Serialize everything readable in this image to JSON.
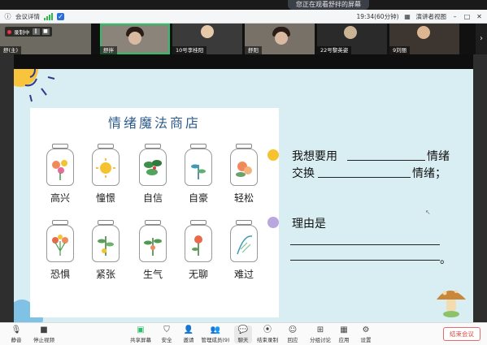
{
  "notice": "您正在观看舒拌的屏幕",
  "topbar": {
    "meeting_details": "会议详情",
    "time": "19:34(60分钟)",
    "view_mode": "演讲者视图",
    "icons": [
      "info-icon",
      "signal-icon",
      "shield-icon",
      "minimize-icon",
      "maximize-icon",
      "close-icon"
    ]
  },
  "participants": [
    {
      "name": "舒(主)",
      "recording_label": "录制中"
    },
    {
      "name": "舒拌"
    },
    {
      "name": "10号李桂阳"
    },
    {
      "name": "舒阳"
    },
    {
      "name": "22号黎英姿"
    },
    {
      "name": "9刘丽"
    }
  ],
  "slide": {
    "title": "情绪魔法商店",
    "emotions_row1": [
      "高兴",
      "憧憬",
      "自信",
      "自豪",
      "轻松"
    ],
    "emotions_row2": [
      "恐惧",
      "紧张",
      "生气",
      "无聊",
      "难过"
    ],
    "q1_line1_a": "我想要用",
    "q1_line1_b": "情绪",
    "q1_line2_a": "交换",
    "q1_line2_b": "情绪；",
    "q2_label": "理由是",
    "q2_end": "。",
    "bullet_colors": [
      "#f5c230",
      "#b9a8e0"
    ]
  },
  "toolbar": {
    "buttons": [
      {
        "label": "静音",
        "icon": "microphone-icon"
      },
      {
        "label": "停止视频",
        "icon": "camera-icon"
      },
      {
        "label": "共享屏幕",
        "icon": "share-screen-icon"
      },
      {
        "label": "安全",
        "icon": "shield-icon"
      },
      {
        "label": "邀请",
        "icon": "invite-icon"
      },
      {
        "label": "管理成员(9)",
        "icon": "members-icon"
      },
      {
        "label": "聊天",
        "icon": "chat-icon"
      },
      {
        "label": "结束录制",
        "icon": "record-icon"
      },
      {
        "label": "回应",
        "icon": "emoji-icon"
      },
      {
        "label": "分组讨论",
        "icon": "breakout-icon"
      },
      {
        "label": "应用",
        "icon": "apps-icon"
      },
      {
        "label": "设置",
        "icon": "settings-icon"
      }
    ],
    "leave": "结束会议"
  }
}
